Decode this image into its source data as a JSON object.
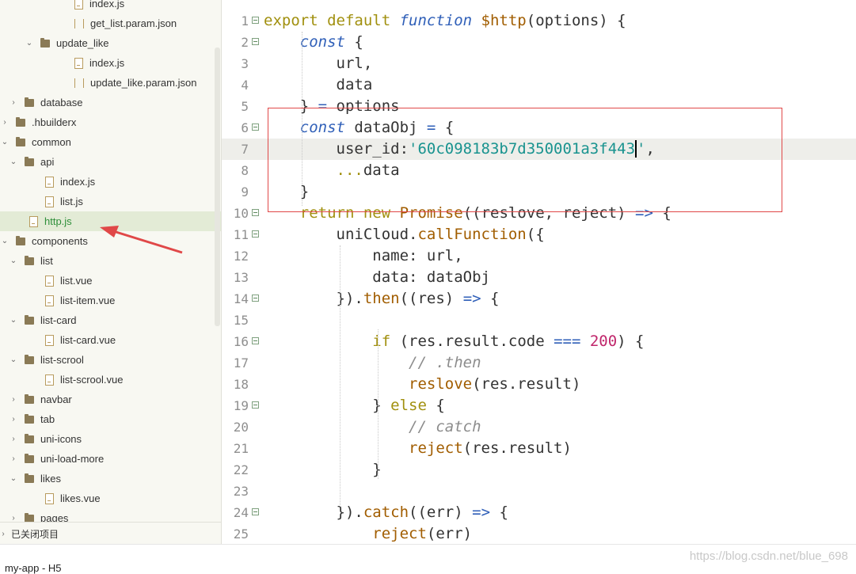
{
  "sidebar": {
    "items": [
      {
        "label": "index.js",
        "icon": "js-file-icon",
        "kind": "file",
        "arrow": ""
      },
      {
        "label": "get_list.param.json",
        "icon": "json-file-icon",
        "kind": "bracket",
        "arrow": ""
      },
      {
        "label": "update_like",
        "icon": "folder-icon",
        "kind": "folder",
        "arrow": "▼"
      },
      {
        "label": "index.js",
        "icon": "js-file-icon",
        "kind": "file",
        "arrow": ""
      },
      {
        "label": "update_like.param.json",
        "icon": "json-file-icon",
        "kind": "bracket",
        "arrow": ""
      },
      {
        "label": "database",
        "icon": "folder-icon",
        "kind": "folder",
        "arrow": "›"
      },
      {
        "label": ".hbuilderx",
        "icon": "folder-icon",
        "kind": "folder",
        "arrow": "›"
      },
      {
        "label": "common",
        "icon": "folder-icon",
        "kind": "folder",
        "arrow": "▼"
      },
      {
        "label": "api",
        "icon": "folder-icon",
        "kind": "folder",
        "arrow": "▼"
      },
      {
        "label": "index.js",
        "icon": "js-file-icon",
        "kind": "file",
        "arrow": ""
      },
      {
        "label": "list.js",
        "icon": "js-file-icon",
        "kind": "file",
        "arrow": ""
      },
      {
        "label": "http.js",
        "icon": "js-file-icon",
        "kind": "file",
        "arrow": "",
        "selected": true
      },
      {
        "label": "components",
        "icon": "folder-icon",
        "kind": "folder",
        "arrow": "▼"
      },
      {
        "label": "list",
        "icon": "folder-icon",
        "kind": "folder",
        "arrow": "▼"
      },
      {
        "label": "list.vue",
        "icon": "vue-file-icon",
        "kind": "file",
        "arrow": ""
      },
      {
        "label": "list-item.vue",
        "icon": "vue-file-icon",
        "kind": "file",
        "arrow": ""
      },
      {
        "label": "list-card",
        "icon": "folder-icon",
        "kind": "folder",
        "arrow": "▼"
      },
      {
        "label": "list-card.vue",
        "icon": "vue-file-icon",
        "kind": "file",
        "arrow": ""
      },
      {
        "label": "list-scrool",
        "icon": "folder-icon",
        "kind": "folder",
        "arrow": "▼"
      },
      {
        "label": "list-scrool.vue",
        "icon": "vue-file-icon",
        "kind": "file",
        "arrow": ""
      },
      {
        "label": "navbar",
        "icon": "folder-icon",
        "kind": "folder",
        "arrow": "›"
      },
      {
        "label": "tab",
        "icon": "folder-icon",
        "kind": "folder",
        "arrow": "›"
      },
      {
        "label": "uni-icons",
        "icon": "folder-icon",
        "kind": "folder",
        "arrow": "›"
      },
      {
        "label": "uni-load-more",
        "icon": "folder-icon",
        "kind": "folder",
        "arrow": "›"
      },
      {
        "label": "likes",
        "icon": "folder-icon",
        "kind": "folder",
        "arrow": "▼"
      },
      {
        "label": "likes.vue",
        "icon": "vue-file-icon",
        "kind": "file",
        "arrow": ""
      },
      {
        "label": "pages",
        "icon": "folder-icon",
        "kind": "folder",
        "arrow": "›"
      }
    ],
    "closed_projects_label": "已关闭项目"
  },
  "status_bar": {
    "text": "my-app - H5"
  },
  "editor": {
    "lines": [
      {
        "n": "1",
        "fold": true,
        "tokens": [
          [
            "kw",
            "export "
          ],
          [
            "kw",
            "default "
          ],
          [
            "type",
            "function "
          ],
          [
            "fn",
            "$http"
          ],
          [
            "var",
            "(options) {"
          ]
        ]
      },
      {
        "n": "2",
        "fold": true,
        "tokens": [
          [
            "var",
            "    "
          ],
          [
            "type",
            "const "
          ],
          [
            "var",
            "{"
          ]
        ]
      },
      {
        "n": "3",
        "fold": false,
        "tokens": [
          [
            "var",
            "        url,"
          ]
        ]
      },
      {
        "n": "4",
        "fold": false,
        "tokens": [
          [
            "var",
            "        data"
          ]
        ]
      },
      {
        "n": "5",
        "fold": false,
        "tokens": [
          [
            "var",
            "    } "
          ],
          [
            "op",
            "= "
          ],
          [
            "var",
            "options"
          ]
        ]
      },
      {
        "n": "6",
        "fold": true,
        "tokens": [
          [
            "var",
            "    "
          ],
          [
            "type",
            "const "
          ],
          [
            "var",
            "dataObj "
          ],
          [
            "op",
            "= "
          ],
          [
            "var",
            "{"
          ]
        ]
      },
      {
        "n": "7",
        "fold": false,
        "current": true,
        "tokens": [
          [
            "var",
            "        user_id:"
          ],
          [
            "str",
            "'60c098183b7d350001a3f443"
          ],
          [
            "cursor",
            ""
          ],
          [
            "str",
            "'"
          ],
          [
            "var",
            ","
          ]
        ]
      },
      {
        "n": "8",
        "fold": false,
        "tokens": [
          [
            "var",
            "        "
          ],
          [
            "kw",
            "..."
          ],
          [
            "var",
            "data"
          ]
        ]
      },
      {
        "n": "9",
        "fold": false,
        "tokens": [
          [
            "var",
            "    }"
          ]
        ]
      },
      {
        "n": "10",
        "fold": true,
        "tokens": [
          [
            "var",
            "    "
          ],
          [
            "kw",
            "return "
          ],
          [
            "kw",
            "new "
          ],
          [
            "fn",
            "Promise"
          ],
          [
            "var",
            "((reslove, reject) "
          ],
          [
            "op",
            "=> "
          ],
          [
            "var",
            "{"
          ]
        ]
      },
      {
        "n": "11",
        "fold": true,
        "tokens": [
          [
            "var",
            "        uniCloud."
          ],
          [
            "fn",
            "callFunction"
          ],
          [
            "var",
            "({"
          ]
        ]
      },
      {
        "n": "12",
        "fold": false,
        "tokens": [
          [
            "var",
            "            name: url,"
          ]
        ]
      },
      {
        "n": "13",
        "fold": false,
        "tokens": [
          [
            "var",
            "            data: dataObj"
          ]
        ]
      },
      {
        "n": "14",
        "fold": true,
        "tokens": [
          [
            "var",
            "        })."
          ],
          [
            "fn",
            "then"
          ],
          [
            "var",
            "((res) "
          ],
          [
            "op",
            "=> "
          ],
          [
            "var",
            "{"
          ]
        ]
      },
      {
        "n": "15",
        "fold": false,
        "tokens": [
          [
            "var",
            ""
          ]
        ]
      },
      {
        "n": "16",
        "fold": true,
        "tokens": [
          [
            "var",
            "            "
          ],
          [
            "kw",
            "if "
          ],
          [
            "var",
            "(res.result.code "
          ],
          [
            "op",
            "=== "
          ],
          [
            "num",
            "200"
          ],
          [
            "var",
            ") {"
          ]
        ]
      },
      {
        "n": "17",
        "fold": false,
        "tokens": [
          [
            "var",
            "                "
          ],
          [
            "cmt",
            "// .then"
          ]
        ]
      },
      {
        "n": "18",
        "fold": false,
        "tokens": [
          [
            "var",
            "                "
          ],
          [
            "fn",
            "reslove"
          ],
          [
            "var",
            "(res.result)"
          ]
        ]
      },
      {
        "n": "19",
        "fold": true,
        "tokens": [
          [
            "var",
            "            } "
          ],
          [
            "kw",
            "else "
          ],
          [
            "var",
            "{"
          ]
        ]
      },
      {
        "n": "20",
        "fold": false,
        "tokens": [
          [
            "var",
            "                "
          ],
          [
            "cmt",
            "// catch"
          ]
        ]
      },
      {
        "n": "21",
        "fold": false,
        "tokens": [
          [
            "var",
            "                "
          ],
          [
            "fn",
            "reject"
          ],
          [
            "var",
            "(res.result)"
          ]
        ]
      },
      {
        "n": "22",
        "fold": false,
        "tokens": [
          [
            "var",
            "            }"
          ]
        ]
      },
      {
        "n": "23",
        "fold": false,
        "tokens": [
          [
            "var",
            ""
          ]
        ]
      },
      {
        "n": "24",
        "fold": true,
        "tokens": [
          [
            "var",
            "        })."
          ],
          [
            "fn",
            "catch"
          ],
          [
            "var",
            "((err) "
          ],
          [
            "op",
            "=> "
          ],
          [
            "var",
            "{"
          ]
        ]
      },
      {
        "n": "25",
        "fold": false,
        "tokens": [
          [
            "var",
            "            "
          ],
          [
            "fn",
            "reject"
          ],
          [
            "var",
            "(err)"
          ]
        ]
      }
    ]
  },
  "watermark": "https://blog.csdn.net/blue_698",
  "colors": {
    "keyword": "#a1900f",
    "type": "#2f5fb8",
    "function": "#a15d00",
    "string": "#19938f",
    "number": "#c0266b",
    "comment": "#8c8c8c",
    "annotation_red": "#e04848",
    "selected_file": "#2f8f3a"
  }
}
